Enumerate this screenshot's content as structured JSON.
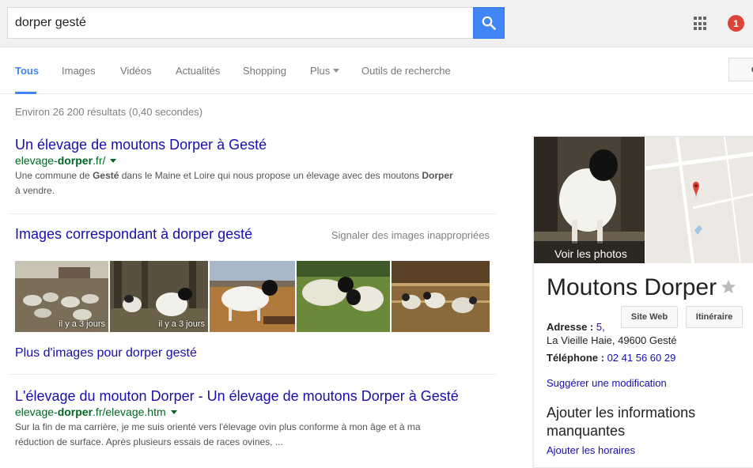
{
  "search": {
    "query": "dorper gesté"
  },
  "notifications": {
    "count": "1"
  },
  "tabs": [
    {
      "label": "Tous"
    },
    {
      "label": "Images"
    },
    {
      "label": "Vidéos"
    },
    {
      "label": "Actualités"
    },
    {
      "label": "Shopping"
    },
    {
      "label": "Plus"
    },
    {
      "label": "Outils de recherche"
    }
  ],
  "stats": "Environ 26 200 résultats (0,40 secondes)",
  "results": [
    {
      "title": "Un élevage de moutons Dorper à Gesté",
      "url_pre": "elevage-",
      "url_bold": "dorper",
      "url_post": ".fr/",
      "snippet_1": "Une commune de ",
      "snippet_2": "Gesté",
      "snippet_3": " dans le Maine et Loire qui nous propose un élevage avec des moutons ",
      "snippet_4": "Dorper",
      "snippet_5": "à vendre."
    },
    {
      "title": "L'élevage du mouton Dorper - Un élevage de moutons Dorper à Gesté",
      "url_pre": "elevage-",
      "url_bold": "dorper",
      "url_post": ".fr/elevage.htm",
      "snippet_1": "Sur la fin de ma carrière, je me suis orienté vers l'élevage ovin plus conforme à mon âge et à ma",
      "snippet_2": "réduction de surface. Après plusieurs essais de races ovines, ..."
    }
  ],
  "images_block": {
    "title": "Images correspondant à dorper gesté",
    "report": "Signaler des images inappropriées",
    "thumbs": [
      {
        "caption": "il y a 3 jours"
      },
      {
        "caption": "il y a 3 jours"
      },
      {
        "caption": ""
      },
      {
        "caption": ""
      },
      {
        "caption": ""
      }
    ],
    "more": "Plus d'images pour dorper gesté"
  },
  "knowledge_panel": {
    "photo_label": "Voir les photos",
    "title": "Moutons Dorper",
    "btn_website": "Site Web",
    "btn_route": "Itinéraire",
    "address_label": "Adresse :",
    "address_num": "5,",
    "address_line2": "La Vieille Haie, 49600 Gesté",
    "phone_label": "Téléphone :",
    "phone": "02 41 56 60 29",
    "suggest": "Suggérer une modification",
    "missing_info": "Ajouter les informations manquantes",
    "add_hours": "Ajouter les horaires"
  },
  "colors": {
    "accent": "#4285f4",
    "link": "#1a0dab",
    "url": "#006621",
    "badge": "#db4437"
  }
}
